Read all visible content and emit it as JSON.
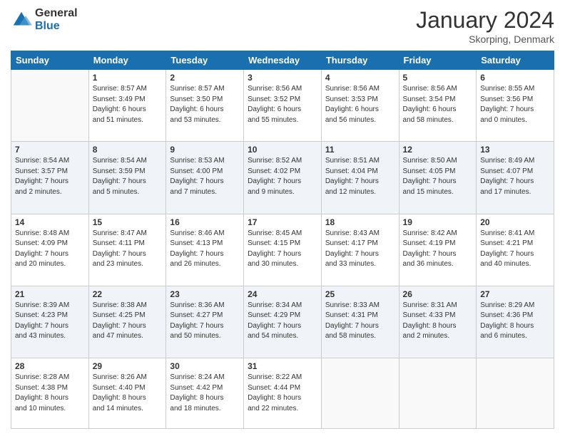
{
  "logo": {
    "general": "General",
    "blue": "Blue"
  },
  "title": "January 2024",
  "subtitle": "Skorping, Denmark",
  "days_header": [
    "Sunday",
    "Monday",
    "Tuesday",
    "Wednesday",
    "Thursday",
    "Friday",
    "Saturday"
  ],
  "weeks": [
    [
      {
        "day": "",
        "info": ""
      },
      {
        "day": "1",
        "info": "Sunrise: 8:57 AM\nSunset: 3:49 PM\nDaylight: 6 hours\nand 51 minutes."
      },
      {
        "day": "2",
        "info": "Sunrise: 8:57 AM\nSunset: 3:50 PM\nDaylight: 6 hours\nand 53 minutes."
      },
      {
        "day": "3",
        "info": "Sunrise: 8:56 AM\nSunset: 3:52 PM\nDaylight: 6 hours\nand 55 minutes."
      },
      {
        "day": "4",
        "info": "Sunrise: 8:56 AM\nSunset: 3:53 PM\nDaylight: 6 hours\nand 56 minutes."
      },
      {
        "day": "5",
        "info": "Sunrise: 8:56 AM\nSunset: 3:54 PM\nDaylight: 6 hours\nand 58 minutes."
      },
      {
        "day": "6",
        "info": "Sunrise: 8:55 AM\nSunset: 3:56 PM\nDaylight: 7 hours\nand 0 minutes."
      }
    ],
    [
      {
        "day": "7",
        "info": "Sunrise: 8:54 AM\nSunset: 3:57 PM\nDaylight: 7 hours\nand 2 minutes."
      },
      {
        "day": "8",
        "info": "Sunrise: 8:54 AM\nSunset: 3:59 PM\nDaylight: 7 hours\nand 5 minutes."
      },
      {
        "day": "9",
        "info": "Sunrise: 8:53 AM\nSunset: 4:00 PM\nDaylight: 7 hours\nand 7 minutes."
      },
      {
        "day": "10",
        "info": "Sunrise: 8:52 AM\nSunset: 4:02 PM\nDaylight: 7 hours\nand 9 minutes."
      },
      {
        "day": "11",
        "info": "Sunrise: 8:51 AM\nSunset: 4:04 PM\nDaylight: 7 hours\nand 12 minutes."
      },
      {
        "day": "12",
        "info": "Sunrise: 8:50 AM\nSunset: 4:05 PM\nDaylight: 7 hours\nand 15 minutes."
      },
      {
        "day": "13",
        "info": "Sunrise: 8:49 AM\nSunset: 4:07 PM\nDaylight: 7 hours\nand 17 minutes."
      }
    ],
    [
      {
        "day": "14",
        "info": "Sunrise: 8:48 AM\nSunset: 4:09 PM\nDaylight: 7 hours\nand 20 minutes."
      },
      {
        "day": "15",
        "info": "Sunrise: 8:47 AM\nSunset: 4:11 PM\nDaylight: 7 hours\nand 23 minutes."
      },
      {
        "day": "16",
        "info": "Sunrise: 8:46 AM\nSunset: 4:13 PM\nDaylight: 7 hours\nand 26 minutes."
      },
      {
        "day": "17",
        "info": "Sunrise: 8:45 AM\nSunset: 4:15 PM\nDaylight: 7 hours\nand 30 minutes."
      },
      {
        "day": "18",
        "info": "Sunrise: 8:43 AM\nSunset: 4:17 PM\nDaylight: 7 hours\nand 33 minutes."
      },
      {
        "day": "19",
        "info": "Sunrise: 8:42 AM\nSunset: 4:19 PM\nDaylight: 7 hours\nand 36 minutes."
      },
      {
        "day": "20",
        "info": "Sunrise: 8:41 AM\nSunset: 4:21 PM\nDaylight: 7 hours\nand 40 minutes."
      }
    ],
    [
      {
        "day": "21",
        "info": "Sunrise: 8:39 AM\nSunset: 4:23 PM\nDaylight: 7 hours\nand 43 minutes."
      },
      {
        "day": "22",
        "info": "Sunrise: 8:38 AM\nSunset: 4:25 PM\nDaylight: 7 hours\nand 47 minutes."
      },
      {
        "day": "23",
        "info": "Sunrise: 8:36 AM\nSunset: 4:27 PM\nDaylight: 7 hours\nand 50 minutes."
      },
      {
        "day": "24",
        "info": "Sunrise: 8:34 AM\nSunset: 4:29 PM\nDaylight: 7 hours\nand 54 minutes."
      },
      {
        "day": "25",
        "info": "Sunrise: 8:33 AM\nSunset: 4:31 PM\nDaylight: 7 hours\nand 58 minutes."
      },
      {
        "day": "26",
        "info": "Sunrise: 8:31 AM\nSunset: 4:33 PM\nDaylight: 8 hours\nand 2 minutes."
      },
      {
        "day": "27",
        "info": "Sunrise: 8:29 AM\nSunset: 4:36 PM\nDaylight: 8 hours\nand 6 minutes."
      }
    ],
    [
      {
        "day": "28",
        "info": "Sunrise: 8:28 AM\nSunset: 4:38 PM\nDaylight: 8 hours\nand 10 minutes."
      },
      {
        "day": "29",
        "info": "Sunrise: 8:26 AM\nSunset: 4:40 PM\nDaylight: 8 hours\nand 14 minutes."
      },
      {
        "day": "30",
        "info": "Sunrise: 8:24 AM\nSunset: 4:42 PM\nDaylight: 8 hours\nand 18 minutes."
      },
      {
        "day": "31",
        "info": "Sunrise: 8:22 AM\nSunset: 4:44 PM\nDaylight: 8 hours\nand 22 minutes."
      },
      {
        "day": "",
        "info": ""
      },
      {
        "day": "",
        "info": ""
      },
      {
        "day": "",
        "info": ""
      }
    ]
  ]
}
